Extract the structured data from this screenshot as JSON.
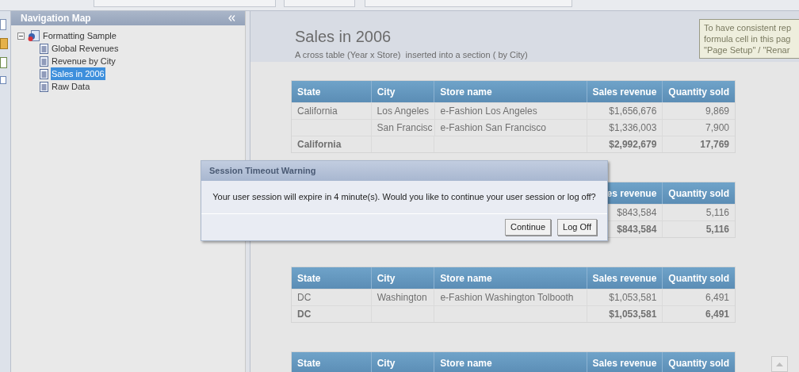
{
  "navigation": {
    "title": "Navigation Map",
    "tree": [
      {
        "label": "Formatting Sample",
        "kind": "report",
        "expanded": true,
        "selected": false,
        "children": [
          {
            "label": "Global Revenues",
            "kind": "page",
            "selected": false
          },
          {
            "label": "Revenue by City",
            "kind": "page",
            "selected": false
          },
          {
            "label": "Sales in 2006",
            "kind": "page",
            "selected": true
          },
          {
            "label": "Raw Data",
            "kind": "page",
            "selected": false
          }
        ]
      }
    ]
  },
  "report": {
    "title": "Sales in 2006",
    "subtitle": "A cross table (Year x Store)  inserted into a section ( by City)",
    "tooltip": [
      "To have consistent rep",
      "formula cell in this pag",
      "\"Page Setup\" / \"Renar"
    ],
    "tables": [
      {
        "columns": [
          "State",
          "City",
          "Store name",
          "Sales revenue",
          "Quantity sold"
        ],
        "rows": [
          {
            "total": false,
            "cells": [
              "California",
              "Los Angeles",
              "e-Fashion Los Angeles",
              "$1,656,676",
              "9,869"
            ]
          },
          {
            "total": false,
            "cells": [
              "",
              "San Francisc",
              "e-Fashion San Francisco",
              "$1,336,003",
              "7,900"
            ]
          },
          {
            "total": true,
            "cells": [
              "California",
              "",
              "",
              "$2,992,679",
              "17,769"
            ]
          }
        ]
      },
      {
        "columns": [
          "es revenue",
          "Quantity sold"
        ],
        "rows": [
          {
            "total": false,
            "cells": [
              "$843,584",
              "5,116"
            ]
          },
          {
            "total": true,
            "cells": [
              "$843,584",
              "5,116"
            ]
          }
        ]
      },
      {
        "columns": [
          "State",
          "City",
          "Store name",
          "Sales revenue",
          "Quantity sold"
        ],
        "rows": [
          {
            "total": false,
            "cells": [
              "DC",
              "Washington",
              "e-Fashion Washington Tolbooth",
              "$1,053,581",
              "6,491"
            ]
          },
          {
            "total": true,
            "cells": [
              "DC",
              "",
              "",
              "$1,053,581",
              "6,491"
            ]
          }
        ]
      },
      {
        "columns": [
          "State",
          "City",
          "Store name",
          "Sales revenue",
          "Quantity sold"
        ]
      }
    ]
  },
  "dialog": {
    "title": "Session Timeout Warning",
    "message": "Your user session will expire in 4 minute(s). Would you like to continue your user session or log off?",
    "buttons": [
      "Continue",
      "Log Off"
    ]
  }
}
